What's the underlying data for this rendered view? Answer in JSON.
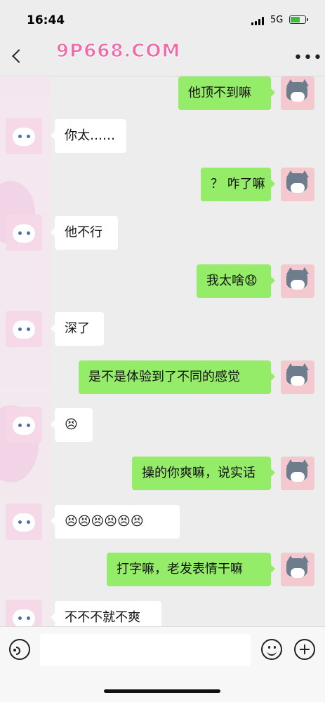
{
  "status": {
    "time": "16:44",
    "network": "5G"
  },
  "watermark": "9P668.COM",
  "messages": [
    {
      "side": "out",
      "text": "他顶不到嘛"
    },
    {
      "side": "in",
      "text": "你太……"
    },
    {
      "side": "out",
      "text": "？ 咋了嘛"
    },
    {
      "side": "in",
      "text": "他不行"
    },
    {
      "side": "out",
      "text": "我太啥😧"
    },
    {
      "side": "in",
      "text": "深了"
    },
    {
      "side": "out",
      "text": "是不是体验到了不同的感觉"
    },
    {
      "side": "in",
      "text": "😣"
    },
    {
      "side": "out",
      "text": "操的你爽嘛，说实话"
    },
    {
      "side": "in",
      "text": "😣😣😣😣😣😣"
    },
    {
      "side": "out",
      "text": "打字嘛，老发表情干嘛"
    },
    {
      "side": "in",
      "text": "不不不就不爽"
    }
  ],
  "input": {
    "placeholder": ""
  },
  "icons": {
    "back": "chevron-left-icon",
    "more": "more-icon",
    "voice": "voice-icon",
    "emoji": "emoji-icon",
    "plus": "plus-icon"
  },
  "colors": {
    "outgoing_bubble": "#95ec69",
    "incoming_bubble": "#ffffff",
    "background": "#ededed"
  }
}
